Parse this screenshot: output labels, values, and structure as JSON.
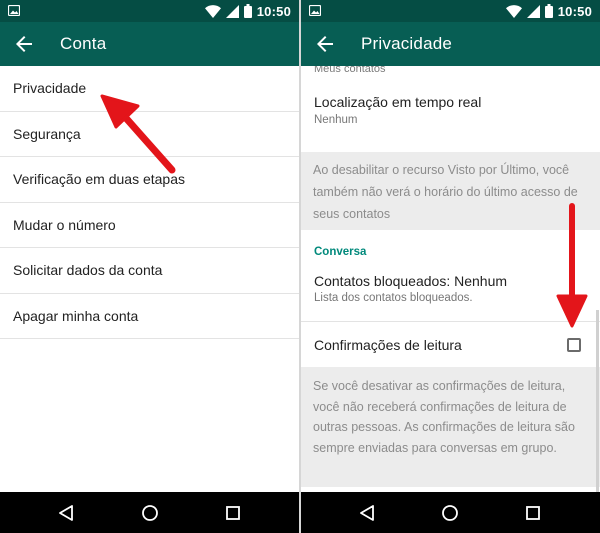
{
  "status_bar": {
    "time": "10:50",
    "icons": [
      "image-icon",
      "wifi-icon",
      "signal-icon",
      "battery-icon"
    ]
  },
  "left_screen": {
    "title": "Conta",
    "back_icon": "arrow-back-icon",
    "items": [
      {
        "label": "Privacidade"
      },
      {
        "label": "Segurança"
      },
      {
        "label": "Verificação em duas etapas"
      },
      {
        "label": "Mudar o número"
      },
      {
        "label": "Solicitar dados da conta"
      },
      {
        "label": "Apagar minha conta"
      }
    ]
  },
  "right_screen": {
    "title": "Privacidade",
    "back_icon": "arrow-back-icon",
    "partial_top_text": "Meus contatos",
    "live_location": {
      "title": "Localização em tempo real",
      "value": "Nenhum"
    },
    "last_seen_info": "Ao desabilitar o recurso Visto por Último, você também não verá o horário do último acesso de seus contatos",
    "section_header": "Conversa",
    "blocked": {
      "title": "Contatos bloqueados: Nenhum",
      "subtitle": "Lista dos contatos bloqueados."
    },
    "read_receipts": {
      "label": "Confirmações de leitura",
      "checked": false
    },
    "read_receipts_info": "Se você desativar as confirmações de leitura, você não receberá confirmações de leitura de outras pessoas. As confirmações de leitura são sempre enviadas para conversas em grupo."
  },
  "nav_bar": {
    "buttons": [
      "back-triangle-icon",
      "home-circle-icon",
      "recents-square-icon"
    ]
  },
  "colors": {
    "status_bar": "#054d44",
    "toolbar": "#075e54",
    "accent": "#00897b",
    "annotation_arrow": "#e3151a",
    "info_background": "#ececec"
  }
}
